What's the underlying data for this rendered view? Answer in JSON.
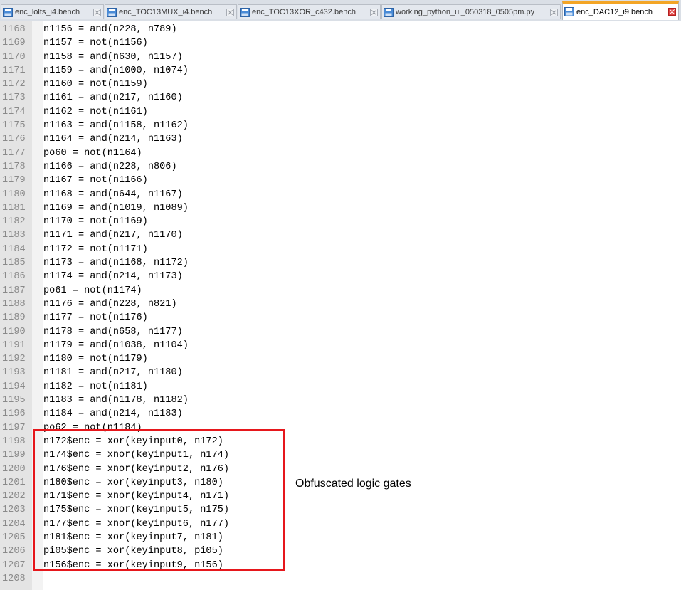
{
  "tabs": [
    {
      "label": "enc_lolts_i4.bench",
      "active": false
    },
    {
      "label": "enc_TOC13MUX_i4.bench",
      "active": false
    },
    {
      "label": "enc_TOC13XOR_c432.bench",
      "active": false
    },
    {
      "label": "working_python_ui_050318_0505pm.py",
      "active": false
    },
    {
      "label": "enc_DAC12_i9.bench",
      "active": true
    }
  ],
  "editor": {
    "lines": [
      {
        "num": "1168",
        "code": "n1156 = and(n228, n789)"
      },
      {
        "num": "1169",
        "code": "n1157 = not(n1156)"
      },
      {
        "num": "1170",
        "code": "n1158 = and(n630, n1157)"
      },
      {
        "num": "1171",
        "code": "n1159 = and(n1000, n1074)"
      },
      {
        "num": "1172",
        "code": "n1160 = not(n1159)"
      },
      {
        "num": "1173",
        "code": "n1161 = and(n217, n1160)"
      },
      {
        "num": "1174",
        "code": "n1162 = not(n1161)"
      },
      {
        "num": "1175",
        "code": "n1163 = and(n1158, n1162)"
      },
      {
        "num": "1176",
        "code": "n1164 = and(n214, n1163)"
      },
      {
        "num": "1177",
        "code": "po60 = not(n1164)"
      },
      {
        "num": "1178",
        "code": "n1166 = and(n228, n806)"
      },
      {
        "num": "1179",
        "code": "n1167 = not(n1166)"
      },
      {
        "num": "1180",
        "code": "n1168 = and(n644, n1167)"
      },
      {
        "num": "1181",
        "code": "n1169 = and(n1019, n1089)"
      },
      {
        "num": "1182",
        "code": "n1170 = not(n1169)"
      },
      {
        "num": "1183",
        "code": "n1171 = and(n217, n1170)"
      },
      {
        "num": "1184",
        "code": "n1172 = not(n1171)"
      },
      {
        "num": "1185",
        "code": "n1173 = and(n1168, n1172)"
      },
      {
        "num": "1186",
        "code": "n1174 = and(n214, n1173)"
      },
      {
        "num": "1187",
        "code": "po61 = not(n1174)"
      },
      {
        "num": "1188",
        "code": "n1176 = and(n228, n821)"
      },
      {
        "num": "1189",
        "code": "n1177 = not(n1176)"
      },
      {
        "num": "1190",
        "code": "n1178 = and(n658, n1177)"
      },
      {
        "num": "1191",
        "code": "n1179 = and(n1038, n1104)"
      },
      {
        "num": "1192",
        "code": "n1180 = not(n1179)"
      },
      {
        "num": "1193",
        "code": "n1181 = and(n217, n1180)"
      },
      {
        "num": "1194",
        "code": "n1182 = not(n1181)"
      },
      {
        "num": "1195",
        "code": "n1183 = and(n1178, n1182)"
      },
      {
        "num": "1196",
        "code": "n1184 = and(n214, n1183)"
      },
      {
        "num": "1197",
        "code": "po62 = not(n1184)"
      },
      {
        "num": "1198",
        "code": "n172$enc = xor(keyinput0, n172)"
      },
      {
        "num": "1199",
        "code": "n174$enc = xnor(keyinput1, n174)"
      },
      {
        "num": "1200",
        "code": "n176$enc = xnor(keyinput2, n176)"
      },
      {
        "num": "1201",
        "code": "n180$enc = xor(keyinput3, n180)"
      },
      {
        "num": "1202",
        "code": "n171$enc = xnor(keyinput4, n171)"
      },
      {
        "num": "1203",
        "code": "n175$enc = xnor(keyinput5, n175)"
      },
      {
        "num": "1204",
        "code": "n177$enc = xnor(keyinput6, n177)"
      },
      {
        "num": "1205",
        "code": "n181$enc = xor(keyinput7, n181)"
      },
      {
        "num": "1206",
        "code": "pi05$enc = xor(keyinput8, pi05)"
      },
      {
        "num": "1207",
        "code": "n156$enc = xor(keyinput9, n156)"
      },
      {
        "num": "1208",
        "code": ""
      }
    ]
  },
  "annotation": {
    "text": "Obfuscated logic gates"
  },
  "colors": {
    "highlight_border": "#e6171c",
    "active_tab_accent": "#f3a526",
    "line_number": "#8a8a8a"
  }
}
